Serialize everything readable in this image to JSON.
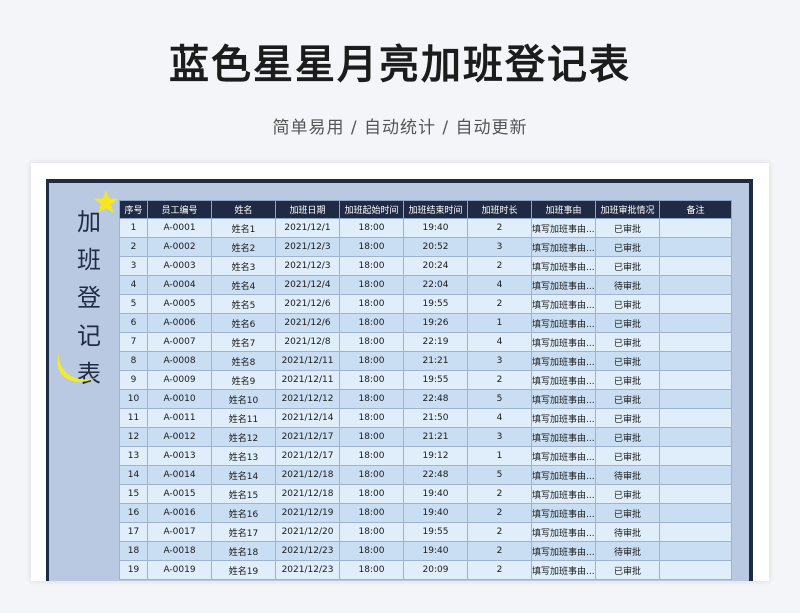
{
  "page": {
    "title": "蓝色星星月亮加班登记表",
    "subtitle": "简单易用 / 自动统计 / 自动更新"
  },
  "sheet": {
    "side_title": [
      "加",
      "班",
      "登",
      "记",
      "表"
    ],
    "columns": [
      "序号",
      "员工编号",
      "姓名",
      "加班日期",
      "加班起始时间",
      "加班结束时间",
      "加班时长",
      "加班事由",
      "加班审批情况",
      "备注"
    ],
    "rows": [
      [
        "1",
        "A-0001",
        "姓名1",
        "2021/12/1",
        "18:00",
        "19:40",
        "2",
        "填写加班事由.....",
        "已审批",
        ""
      ],
      [
        "2",
        "A-0002",
        "姓名2",
        "2021/12/3",
        "18:00",
        "20:52",
        "3",
        "填写加班事由.....",
        "已审批",
        ""
      ],
      [
        "3",
        "A-0003",
        "姓名3",
        "2021/12/3",
        "18:00",
        "20:24",
        "2",
        "填写加班事由.....",
        "已审批",
        ""
      ],
      [
        "4",
        "A-0004",
        "姓名4",
        "2021/12/4",
        "18:00",
        "22:04",
        "4",
        "填写加班事由.....",
        "待审批",
        ""
      ],
      [
        "5",
        "A-0005",
        "姓名5",
        "2021/12/6",
        "18:00",
        "19:55",
        "2",
        "填写加班事由.....",
        "已审批",
        ""
      ],
      [
        "6",
        "A-0006",
        "姓名6",
        "2021/12/6",
        "18:00",
        "19:26",
        "1",
        "填写加班事由.....",
        "已审批",
        ""
      ],
      [
        "7",
        "A-0007",
        "姓名7",
        "2021/12/8",
        "18:00",
        "22:19",
        "4",
        "填写加班事由.....",
        "已审批",
        ""
      ],
      [
        "8",
        "A-0008",
        "姓名8",
        "2021/12/11",
        "18:00",
        "21:21",
        "3",
        "填写加班事由.....",
        "已审批",
        ""
      ],
      [
        "9",
        "A-0009",
        "姓名9",
        "2021/12/11",
        "18:00",
        "19:55",
        "2",
        "填写加班事由.....",
        "已审批",
        ""
      ],
      [
        "10",
        "A-0010",
        "姓名10",
        "2021/12/12",
        "18:00",
        "22:48",
        "5",
        "填写加班事由.....",
        "已审批",
        ""
      ],
      [
        "11",
        "A-0011",
        "姓名11",
        "2021/12/14",
        "18:00",
        "21:50",
        "4",
        "填写加班事由.....",
        "已审批",
        ""
      ],
      [
        "12",
        "A-0012",
        "姓名12",
        "2021/12/17",
        "18:00",
        "21:21",
        "3",
        "填写加班事由.....",
        "已审批",
        ""
      ],
      [
        "13",
        "A-0013",
        "姓名13",
        "2021/12/17",
        "18:00",
        "19:12",
        "1",
        "填写加班事由.....",
        "已审批",
        ""
      ],
      [
        "14",
        "A-0014",
        "姓名14",
        "2021/12/18",
        "18:00",
        "22:48",
        "5",
        "填写加班事由.....",
        "待审批",
        ""
      ],
      [
        "15",
        "A-0015",
        "姓名15",
        "2021/12/18",
        "18:00",
        "19:40",
        "2",
        "填写加班事由.....",
        "已审批",
        ""
      ],
      [
        "16",
        "A-0016",
        "姓名16",
        "2021/12/19",
        "18:00",
        "19:40",
        "2",
        "填写加班事由.....",
        "已审批",
        ""
      ],
      [
        "17",
        "A-0017",
        "姓名17",
        "2021/12/20",
        "18:00",
        "19:55",
        "2",
        "填写加班事由.....",
        "待审批",
        ""
      ],
      [
        "18",
        "A-0018",
        "姓名18",
        "2021/12/23",
        "18:00",
        "19:40",
        "2",
        "填写加班事由.....",
        "待审批",
        ""
      ],
      [
        "19",
        "A-0019",
        "姓名19",
        "2021/12/23",
        "18:00",
        "20:09",
        "2",
        "填写加班事由.....",
        "已审批",
        ""
      ]
    ]
  },
  "colors": {
    "header_bg": "#1f2b45",
    "row_light": "#dfeefa",
    "row_dark": "#c9def2",
    "panel": "#b8c9e1",
    "star": "#f5e620",
    "moon": "#f2ea2a"
  },
  "icons": {
    "star": "star-icon",
    "moon": "moon-icon"
  }
}
